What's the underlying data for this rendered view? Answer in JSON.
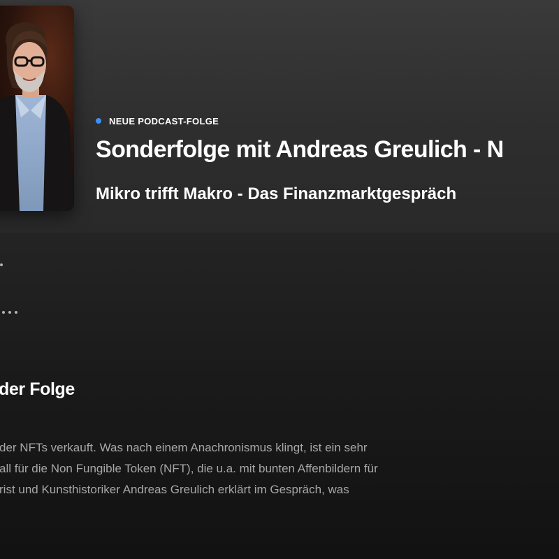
{
  "header": {
    "badge": "NEUE PODCAST-FOLGE",
    "title": "Sonderfolge mit Andreas Greulich - N",
    "show": "Mikro trifft Makro - Das Finanzmarktgespräch",
    "cover_alt": "podcast-cover-photo"
  },
  "episode": {
    "more_icon": "more-options-icon",
    "section_heading": "der Folge",
    "description_lines": [
      "der NFTs verkauft. Was nach einem Anachronismus klingt, ist ein sehr",
      "all für die Non Fungible Token (NFT), die u.a. mit bunten Affenbildern für",
      "rist und Kunsthistoriker Andreas Greulich erklärt im Gespräch, was"
    ]
  },
  "colors": {
    "background": "#121212",
    "header_bg": "#333333",
    "accent_dot": "#3d91f4",
    "secondary_text": "#a7a7a7"
  }
}
